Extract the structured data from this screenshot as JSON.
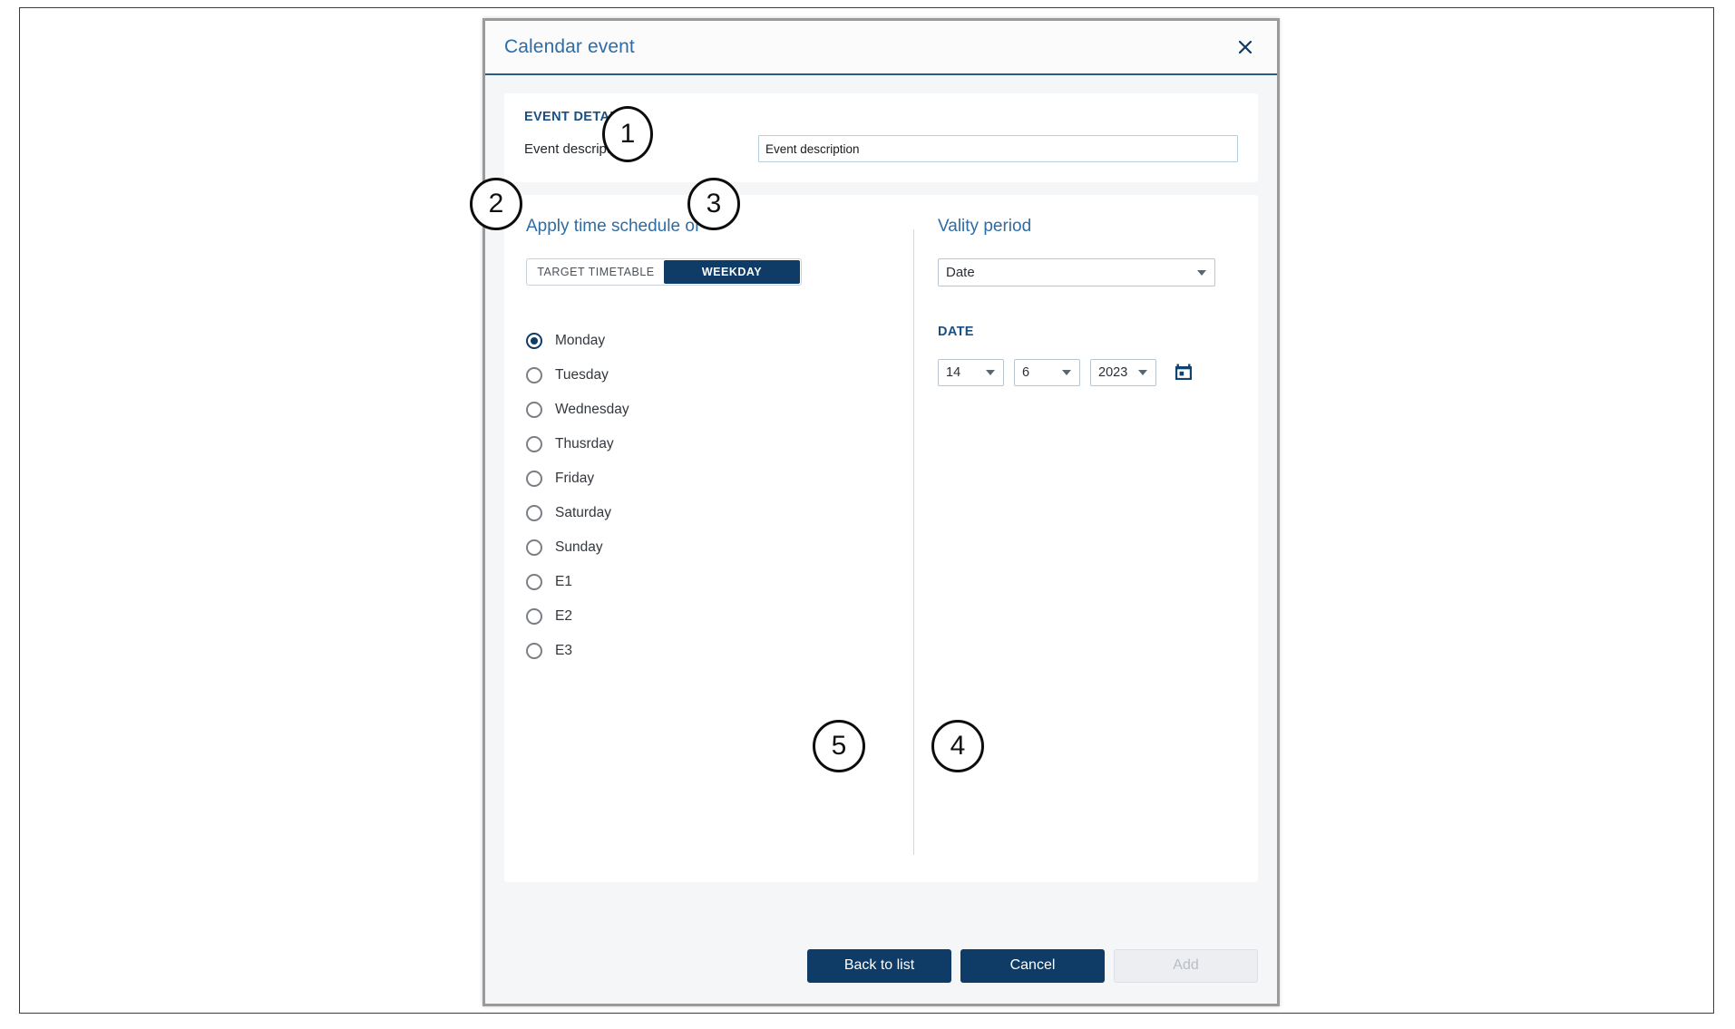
{
  "dialog": {
    "title": "Calendar event",
    "close_icon": "close-icon"
  },
  "event_detail": {
    "section_title": "EVENT DETAIL",
    "description_label": "Event description:",
    "description_value": "Event description",
    "description_placeholder": "Event description"
  },
  "schedule": {
    "heading": "Apply time schedule of",
    "tabs": [
      {
        "label": "TARGET TIMETABLE",
        "active": false
      },
      {
        "label": "WEEKDAY",
        "active": true
      }
    ],
    "options": [
      {
        "label": "Monday",
        "selected": true
      },
      {
        "label": "Tuesday",
        "selected": false
      },
      {
        "label": "Wednesday",
        "selected": false
      },
      {
        "label": "Thusrday",
        "selected": false
      },
      {
        "label": "Friday",
        "selected": false
      },
      {
        "label": "Saturday",
        "selected": false
      },
      {
        "label": "Sunday",
        "selected": false
      },
      {
        "label": "E1",
        "selected": false
      },
      {
        "label": "E2",
        "selected": false
      },
      {
        "label": "E3",
        "selected": false
      }
    ]
  },
  "validity": {
    "heading": "Vality period",
    "type_select_value": "Date",
    "date_section_title": "DATE",
    "day": "14",
    "month": "6",
    "year": "2023",
    "calendar_icon": "calendar-icon"
  },
  "footer": {
    "back_label": "Back to list",
    "cancel_label": "Cancel",
    "add_label": "Add"
  },
  "markers": {
    "m1": "1",
    "m2": "2",
    "m3": "3",
    "m4": "4",
    "m5": "5"
  },
  "colors": {
    "brand_navy": "#0e3c66",
    "heading_blue": "#2e6ca4",
    "caps_blue": "#1b4f83",
    "dialog_bg": "#f5f6f8"
  }
}
